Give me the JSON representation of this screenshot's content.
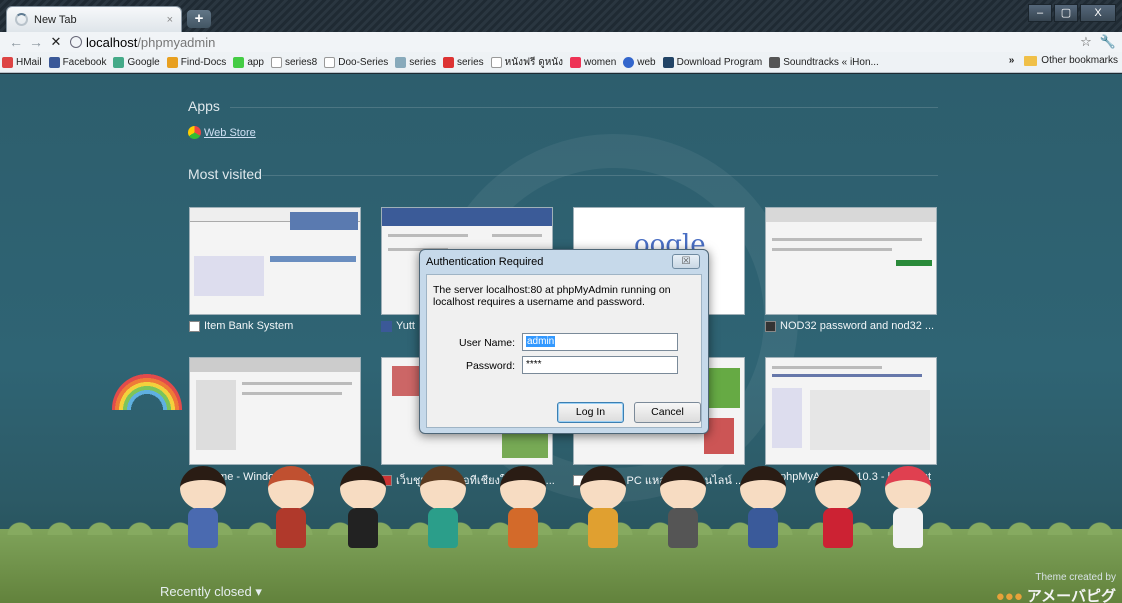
{
  "browser": {
    "tab_title": "New Tab",
    "tab_close": "×",
    "new_tab": "+",
    "window_controls": [
      "–",
      "▢",
      "X"
    ],
    "url_host": "localhost",
    "url_path": "/phpmyadmin",
    "star_icon": "☆",
    "wrench_icon": "🔧"
  },
  "bookmarks": {
    "items": [
      {
        "label": "HMail",
        "color": "#d44"
      },
      {
        "label": "Facebook",
        "color": "#3b5998"
      },
      {
        "label": "Google",
        "color": "#4a8"
      },
      {
        "label": "Find-Docs",
        "color": "#e8a020"
      },
      {
        "label": "app",
        "color": "#4c4"
      },
      {
        "label": "series8",
        "color": "#ffffff"
      },
      {
        "label": "Doo-Series",
        "color": "#ffffff"
      },
      {
        "label": "series",
        "color": "#8ab"
      },
      {
        "label": "series",
        "color": "#d33"
      },
      {
        "label": "หนังฟรี ดูหนัง",
        "color": "#ffffff"
      },
      {
        "label": "women",
        "color": "#e35"
      },
      {
        "label": "web",
        "color": "#36c"
      },
      {
        "label": "Download Program",
        "color": "#246"
      },
      {
        "label": "Soundtracks « iHon...",
        "color": "#555"
      }
    ],
    "overflow": "»",
    "other": "Other bookmarks"
  },
  "ntp": {
    "apps_title": "Apps",
    "web_store": "Web Store",
    "most_visited_title": "Most visited",
    "recently_closed": "Recently closed ▾",
    "thumbnails": [
      {
        "caption": "Item Bank System"
      },
      {
        "caption": "Yutt"
      },
      {
        "caption": ""
      },
      {
        "caption": "NOD32 password and nod32 ..."
      },
      {
        "caption": "Home - Windows Live"
      },
      {
        "caption": "เว็บชุมชนคนไอทีเชียงใหม่ และ ..."
      },
      {
        "caption": "series8 PC แหล่งซีรี่ส์ออนไลน์ ..."
      },
      {
        "caption": "phpMyAdmin 2.10.3 - localhost"
      }
    ],
    "theme_credit": "Theme created by",
    "theme_logo": "アメーバピグ"
  },
  "dialog": {
    "title": "Authentication Required",
    "close_label": "☒",
    "message": "The server localhost:80 at phpMyAdmin running on localhost requires a username and password.",
    "username_label": "User Name:",
    "username_value": "admin",
    "password_label": "Password:",
    "password_value": "****",
    "login_label": "Log In",
    "cancel_label": "Cancel"
  }
}
